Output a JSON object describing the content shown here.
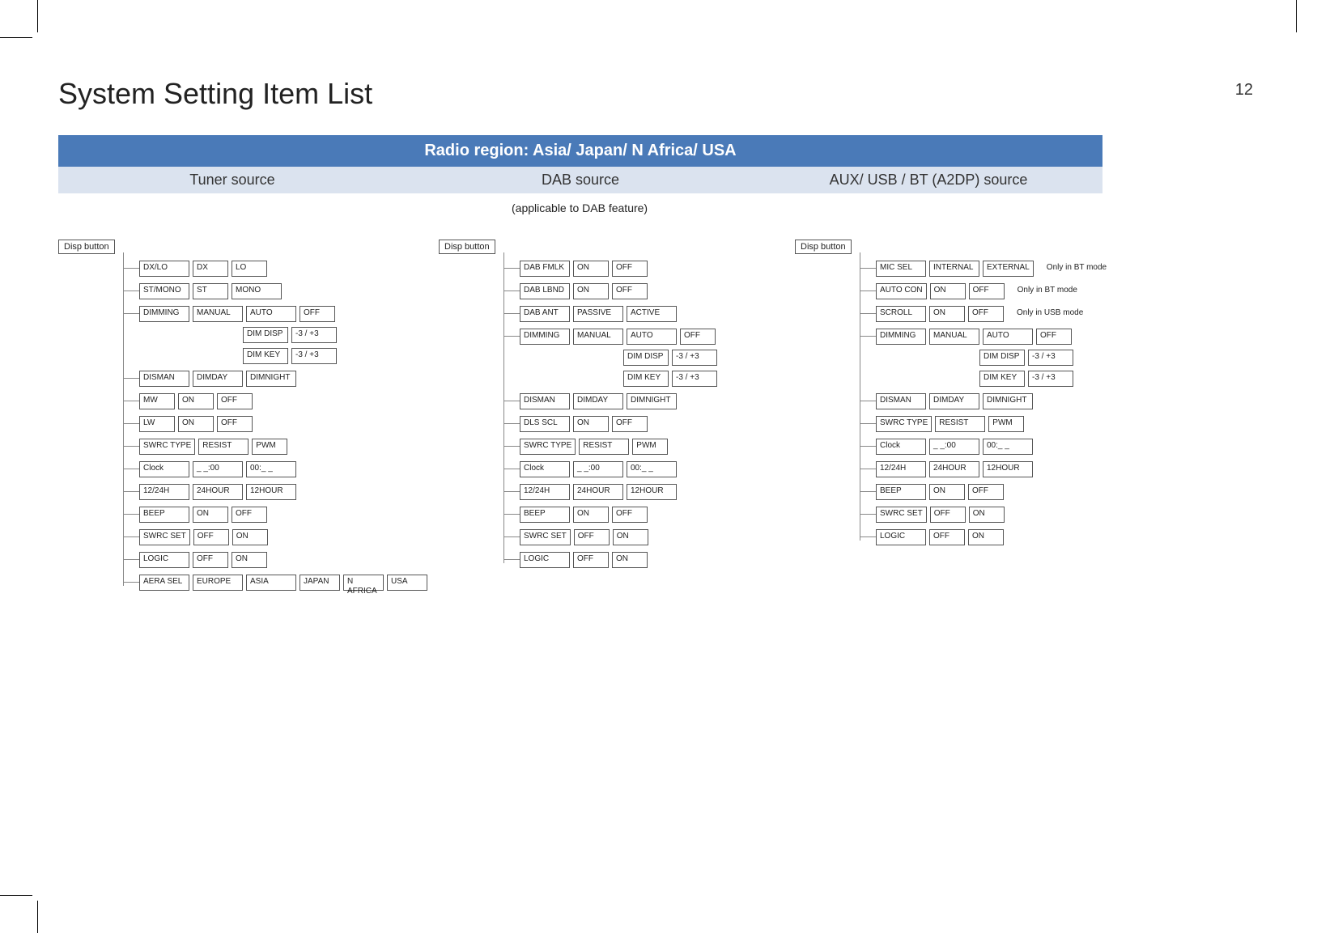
{
  "page_number": "12",
  "title": "System Setting Item List",
  "banner": "Radio region: Asia/ Japan/ N Africa/ USA",
  "columns": {
    "tuner": "Tuner source",
    "dab": "DAB source",
    "aux": "AUX/ USB / BT (A2DP) source"
  },
  "dab_note": "(applicable to DAB feature)",
  "disp_label": "Disp button",
  "tuner_tree": {
    "rows": [
      {
        "cells": [
          "DX/LO",
          "DX",
          "LO"
        ]
      },
      {
        "cells": [
          "ST/MONO",
          "ST",
          "MONO"
        ]
      },
      {
        "cells": [
          "DIMMING",
          "MANUAL",
          "AUTO",
          "OFF"
        ],
        "sub": [
          {
            "cells": [
              "DIM DISP",
              "-3 / +3"
            ]
          },
          {
            "cells": [
              "DIM KEY",
              "-3 / +3"
            ]
          }
        ]
      },
      {
        "cells": [
          "DISMAN",
          "DIMDAY",
          "DIMNIGHT"
        ]
      },
      {
        "cells": [
          "MW",
          "ON",
          "OFF"
        ]
      },
      {
        "cells": [
          "LW",
          "ON",
          "OFF"
        ]
      },
      {
        "cells": [
          "SWRC TYPE",
          "RESIST",
          "PWM"
        ]
      },
      {
        "cells": [
          "Clock",
          "_ _:00",
          "00:_ _"
        ]
      },
      {
        "cells": [
          "12/24H",
          "24HOUR",
          "12HOUR"
        ]
      },
      {
        "cells": [
          "BEEP",
          "ON",
          "OFF"
        ]
      },
      {
        "cells": [
          "SWRC SET",
          "OFF",
          "ON"
        ]
      },
      {
        "cells": [
          "LOGIC",
          "OFF",
          "ON"
        ]
      },
      {
        "cells": [
          "AERA SEL",
          "EUROPE",
          "ASIA",
          "JAPAN",
          "N AFRICA",
          "USA"
        ]
      }
    ]
  },
  "dab_tree": {
    "rows": [
      {
        "cells": [
          "DAB FMLK",
          "ON",
          "OFF"
        ]
      },
      {
        "cells": [
          "DAB  LBND",
          "ON",
          "OFF"
        ]
      },
      {
        "cells": [
          "DAB ANT",
          "PASSIVE",
          "ACTIVE"
        ]
      },
      {
        "cells": [
          "DIMMING",
          "MANUAL",
          "AUTO",
          "OFF"
        ],
        "sub": [
          {
            "cells": [
              "DIM DISP",
              "-3 / +3"
            ]
          },
          {
            "cells": [
              "DIM KEY",
              "-3 / +3"
            ]
          }
        ]
      },
      {
        "cells": [
          "DISMAN",
          "DIMDAY",
          "DIMNIGHT"
        ]
      },
      {
        "cells": [
          "DLS SCL",
          "ON",
          "OFF"
        ]
      },
      {
        "cells": [
          "SWRC TYPE",
          "RESIST",
          "PWM"
        ]
      },
      {
        "cells": [
          "Clock",
          "_ _:00",
          "00:_ _"
        ]
      },
      {
        "cells": [
          "12/24H",
          "24HOUR",
          "12HOUR"
        ]
      },
      {
        "cells": [
          "BEEP",
          "ON",
          "OFF"
        ]
      },
      {
        "cells": [
          "SWRC SET",
          "OFF",
          "ON"
        ]
      },
      {
        "cells": [
          "LOGIC",
          "OFF",
          "ON"
        ]
      }
    ]
  },
  "aux_tree": {
    "rows": [
      {
        "cells": [
          "MIC SEL",
          "INTERNAL",
          "EXTERNAL"
        ],
        "note": "Only in BT mode"
      },
      {
        "cells": [
          "AUTO CON",
          "ON",
          "OFF"
        ],
        "note": "Only in BT mode"
      },
      {
        "cells": [
          "SCROLL",
          "ON",
          "OFF"
        ],
        "note": "Only in USB mode"
      },
      {
        "cells": [
          "DIMMING",
          "MANUAL",
          "AUTO",
          "OFF"
        ],
        "sub": [
          {
            "cells": [
              "DIM DISP",
              "-3 / +3"
            ]
          },
          {
            "cells": [
              "DIM KEY",
              "-3 / +3"
            ]
          }
        ]
      },
      {
        "cells": [
          "DISMAN",
          "DIMDAY",
          "DIMNIGHT"
        ]
      },
      {
        "cells": [
          "SWRC TYPE",
          "RESIST",
          "PWM"
        ]
      },
      {
        "cells": [
          "Clock",
          "_ _:00",
          "00:_ _"
        ]
      },
      {
        "cells": [
          "12/24H",
          "24HOUR",
          "12HOUR"
        ]
      },
      {
        "cells": [
          "BEEP",
          "ON",
          "OFF"
        ]
      },
      {
        "cells": [
          "SWRC SET",
          "OFF",
          "ON"
        ]
      },
      {
        "cells": [
          "LOGIC",
          "OFF",
          "ON"
        ]
      }
    ]
  }
}
